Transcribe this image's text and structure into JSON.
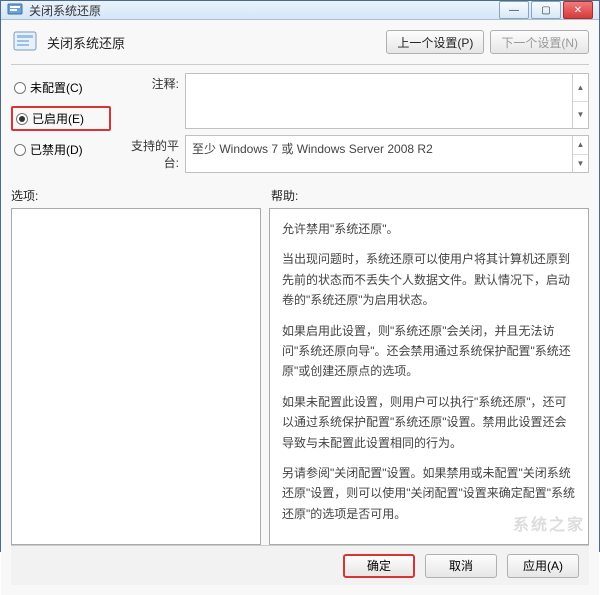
{
  "titlebar": {
    "title": "关闭系统还原",
    "min": "—",
    "max": "▢",
    "close": "✕"
  },
  "header": {
    "title": "关闭系统还原",
    "prev_btn": "上一个设置(P)",
    "next_btn": "下一个设置(N)"
  },
  "radios": {
    "not_configured": "未配置(C)",
    "enabled": "已启用(E)",
    "disabled": "已禁用(D)"
  },
  "fields": {
    "comment_label": "注释:",
    "platform_label": "支持的平台:",
    "platform_value": "至少 Windows 7 或 Windows Server 2008 R2"
  },
  "sections": {
    "options_label": "选项:",
    "help_label": "帮助:"
  },
  "help": {
    "p1": "允许禁用\"系统还原\"。",
    "p2": "当出现问题时，系统还原可以使用户将其计算机还原到先前的状态而不丢失个人数据文件。默认情况下，启动卷的\"系统还原\"为启用状态。",
    "p3": "如果启用此设置，则\"系统还原\"会关闭，并且无法访问\"系统还原向导\"。还会禁用通过系统保护配置\"系统还原\"或创建还原点的选项。",
    "p4": "如果未配置此设置，则用户可以执行\"系统还原\"，还可以通过系统保护配置\"系统还原\"设置。禁用此设置还会导致与未配置此设置相同的行为。",
    "p5": "另请参阅\"关闭配置\"设置。如果禁用或未配置\"关闭系统还原\"设置，则可以使用\"关闭配置\"设置来确定配置\"系统还原\"的选项是否可用。"
  },
  "footer": {
    "ok": "确定",
    "cancel": "取消",
    "apply": "应用(A)"
  },
  "watermark": "系统之家"
}
